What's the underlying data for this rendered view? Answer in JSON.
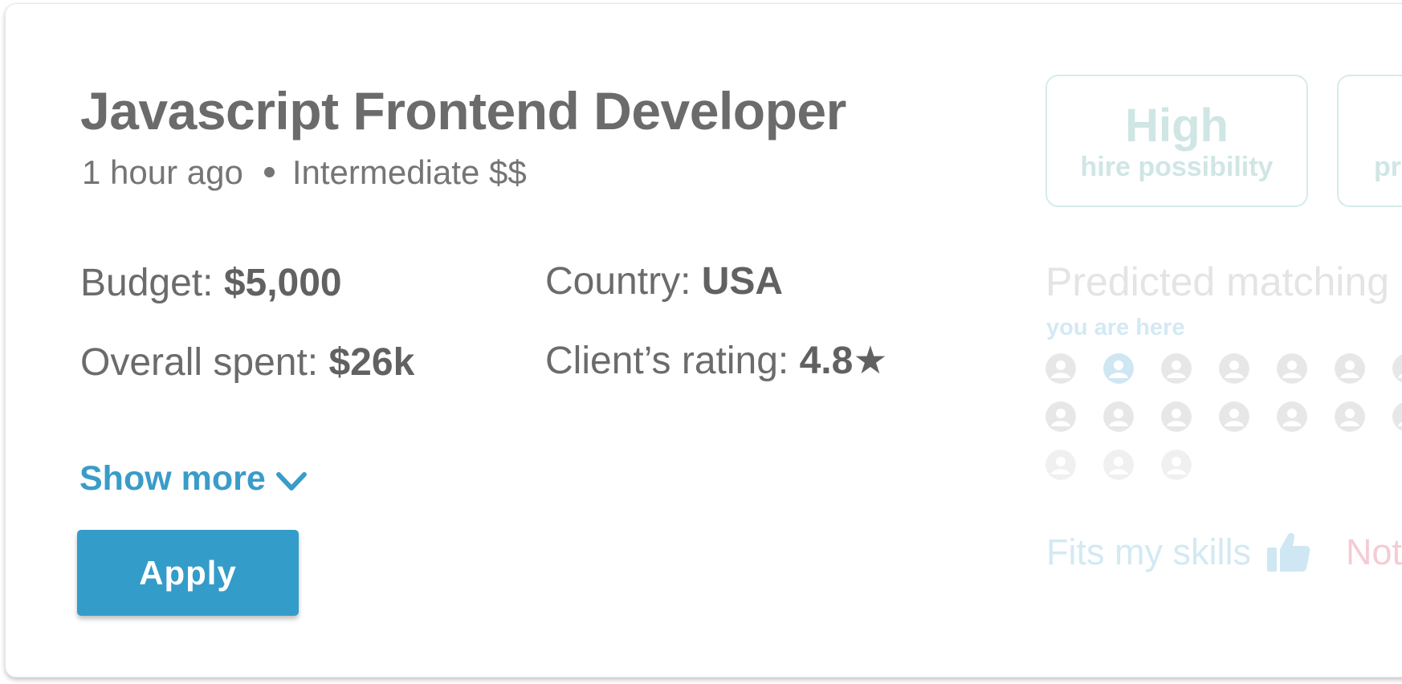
{
  "job": {
    "title": "Javascript Frontend Developer",
    "posted": "1 hour ago",
    "level": "Intermediate $$",
    "budget_label": "Budget:",
    "budget_value": "$5,000",
    "country_label": "Country:",
    "country_value": "USA",
    "spent_label": "Overall spent:",
    "spent_value": "$26k",
    "rating_label": "Client’s rating:",
    "rating_value": "4.8★"
  },
  "actions": {
    "show_more": "Show more",
    "apply": "Apply"
  },
  "badges": [
    {
      "big": "High",
      "small": "hire possibility"
    },
    {
      "big": "",
      "small": "pr"
    }
  ],
  "prediction": {
    "title": "Predicted matching l",
    "you_are_here": "you are here",
    "avatar_rows": [
      7,
      7,
      3
    ],
    "highlighted_index": 1
  },
  "feedback": {
    "fits": "Fits my skills",
    "not": "Not"
  },
  "colors": {
    "text_dark": "#6b6b6b",
    "accent_blue": "#349cc9",
    "badge_teal": "#cfe6e4",
    "avatar_gray": "#e7e7e7",
    "avatar_highlight": "#cfe7f3",
    "not_pink": "#f4ccd3"
  }
}
